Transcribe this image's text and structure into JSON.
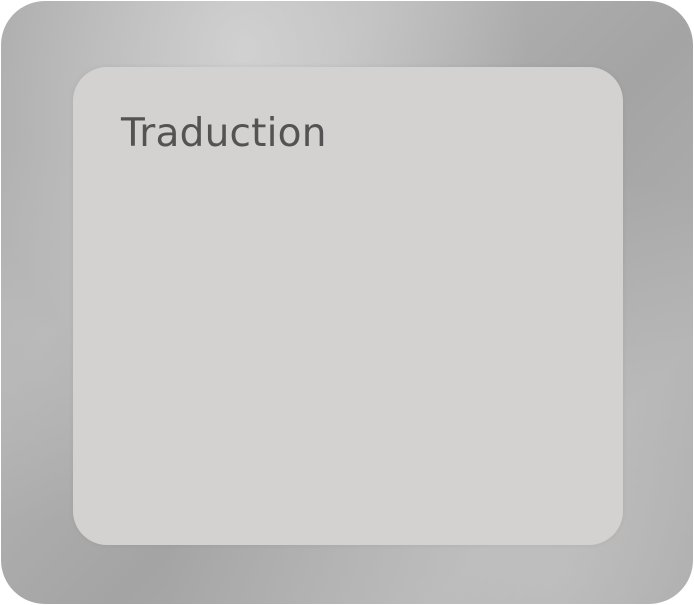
{
  "widget": {
    "title": "Traduction"
  },
  "colors": {
    "frame": "#a9a9a9",
    "card": "#d4d2d1",
    "title_text": "#545353"
  }
}
